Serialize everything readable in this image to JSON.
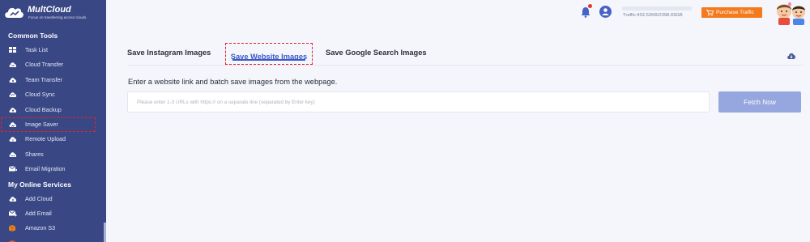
{
  "brand": {
    "name": "MultCloud",
    "tagline": "Focus on transferring across clouds."
  },
  "sidebar": {
    "common_tools_title": "Common Tools",
    "common_tools": [
      {
        "label": "Task List",
        "icon": "grid-icon"
      },
      {
        "label": "Cloud Transfer",
        "icon": "cloud-transfer-icon"
      },
      {
        "label": "Team Transfer",
        "icon": "team-transfer-icon"
      },
      {
        "label": "Cloud Sync",
        "icon": "cloud-sync-icon"
      },
      {
        "label": "Cloud Backup",
        "icon": "cloud-backup-icon"
      },
      {
        "label": "Image Saver",
        "icon": "image-saver-icon"
      },
      {
        "label": "Remote Upload",
        "icon": "remote-upload-icon"
      },
      {
        "label": "Shares",
        "icon": "share-icon"
      },
      {
        "label": "Email Migration",
        "icon": "email-migration-icon"
      }
    ],
    "online_services_title": "My Online Services",
    "online_services": [
      {
        "label": "Add Cloud",
        "icon": "add-cloud-icon"
      },
      {
        "label": "Add Email",
        "icon": "add-email-icon"
      },
      {
        "label": "Amazon S3",
        "icon": "amazon-s3-icon"
      },
      {
        "label": "",
        "icon": "partial-item-icon"
      }
    ]
  },
  "header": {
    "traffic_text": "Traffic:402.52KB/2398.69GB",
    "traffic_used_fraction": 0.0,
    "purchase_label": "Purchase Traffic"
  },
  "tabs": [
    {
      "label": "Save Instagram Images",
      "active": false
    },
    {
      "label": "Save Website Images",
      "active": true
    },
    {
      "label": "Save Google Search Images",
      "active": false
    }
  ],
  "main": {
    "description": "Enter a website link and batch save images from the webpage.",
    "url_placeholder": "Please enter 1-3 URLs with https:// on a separate line (separated by Enter key)",
    "url_value": "",
    "fetch_label": "Fetch Now"
  },
  "colors": {
    "sidebar_bg": "#3a4785",
    "accent": "#3b59c5",
    "purchase": "#f47a1e",
    "fetch_button": "#96a6de",
    "highlight_dash": "#e0242a"
  }
}
